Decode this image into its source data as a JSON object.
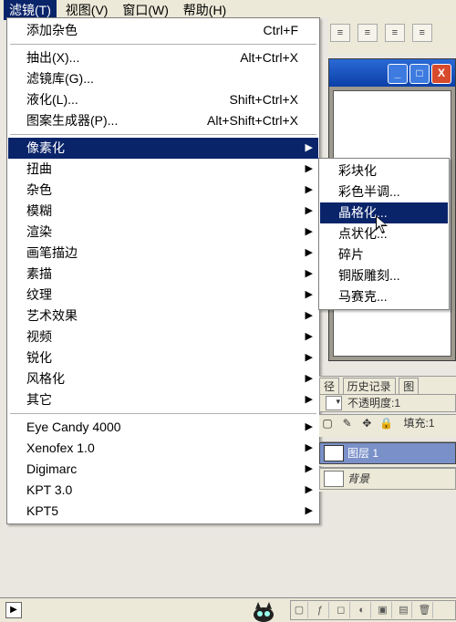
{
  "menubar": {
    "items": [
      {
        "label": "滤镜(T)",
        "active": true
      },
      {
        "label": "视图(V)"
      },
      {
        "label": "窗口(W)"
      },
      {
        "label": "帮助(H)"
      }
    ]
  },
  "filter_menu": {
    "add_noise_label": "添加杂色",
    "add_noise_shortcut": "Ctrl+F",
    "extract_label": "抽出(X)...",
    "extract_shortcut": "Alt+Ctrl+X",
    "filter_gallery_label": "滤镜库(G)...",
    "liquify_label": "液化(L)...",
    "liquify_shortcut": "Shift+Ctrl+X",
    "pattern_maker_label": "图案生成器(P)...",
    "pattern_maker_shortcut": "Alt+Shift+Ctrl+X",
    "groups": [
      "像素化",
      "扭曲",
      "杂色",
      "模糊",
      "渲染",
      "画笔描边",
      "素描",
      "纹理",
      "艺术效果",
      "视频",
      "锐化",
      "风格化",
      "其它"
    ],
    "plugins": [
      "Eye Candy 4000",
      "Xenofex 1.0",
      "Digimarc",
      "KPT 3.0",
      "KPT5"
    ]
  },
  "pixelate_submenu": {
    "items": [
      "彩块化",
      "彩色半调...",
      "晶格化...",
      "点状化...",
      "碎片",
      "铜版雕刻...",
      "马赛克..."
    ],
    "highlight_index": 2
  },
  "right_panels": {
    "tabs": [
      "径",
      "历史记录",
      "图"
    ],
    "opacity_label": "不透明度:",
    "opacity_value": "1",
    "fill_label": "填充:",
    "fill_value": "1",
    "layer1_label": "图层 1",
    "bg_layer_label": "背景"
  },
  "window_buttons": {
    "min": "_",
    "max": "□",
    "close": "X"
  }
}
